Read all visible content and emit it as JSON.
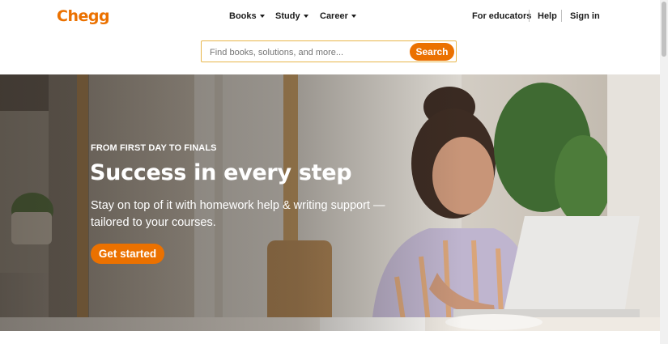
{
  "header": {
    "logo_text": "Chegg",
    "nav": [
      {
        "label": "Books"
      },
      {
        "label": "Study"
      },
      {
        "label": "Career"
      }
    ],
    "right_links": [
      {
        "label": "For educators"
      },
      {
        "label": "Help"
      },
      {
        "label": "Sign in"
      }
    ]
  },
  "search": {
    "placeholder": "Find books, solutions, and more...",
    "value": "",
    "button_label": "Search"
  },
  "hero": {
    "eyebrow": "FROM FIRST DAY TO FINALS",
    "title": "Success in every step",
    "body": "Stay on top of it with homework help & writing support —tailored to your courses.",
    "cta_label": "Get started"
  },
  "colors": {
    "brand": "#eb7100",
    "text": "#1b1b1b",
    "search_border": "#e8b64a"
  }
}
